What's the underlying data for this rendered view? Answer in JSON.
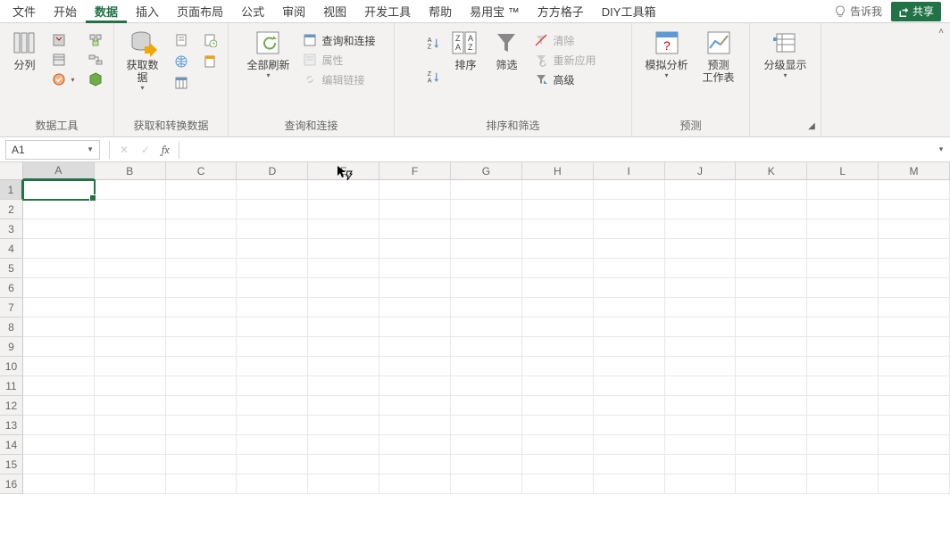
{
  "tabs": {
    "file": "文件",
    "home": "开始",
    "data": "数据",
    "insert": "插入",
    "page_layout": "页面布局",
    "formulas": "公式",
    "review": "审阅",
    "view": "视图",
    "developer": "开发工具",
    "help": "帮助",
    "yiyongbao": "易用宝 ™",
    "fangfang": "方方格子",
    "diy": "DIY工具箱",
    "tell_me": "告诉我",
    "share": "共享"
  },
  "ribbon": {
    "group_data_tools": {
      "label": "数据工具",
      "text_to_columns": "分列"
    },
    "group_get_transform": {
      "label": "获取和转换数据",
      "get_data": "获取数\n据"
    },
    "group_queries": {
      "label": "查询和连接",
      "refresh_all": "全部刷新",
      "queries_connections": "查询和连接",
      "properties": "属性",
      "edit_links": "编辑链接"
    },
    "group_sort_filter": {
      "label": "排序和筛选",
      "sort": "排序",
      "filter": "筛选",
      "clear": "清除",
      "reapply": "重新应用",
      "advanced": "高级"
    },
    "group_forecast": {
      "label": "预测",
      "whatif": "模拟分析",
      "forecast_sheet": "预测\n工作表"
    },
    "group_outline": {
      "label": "分级显示"
    }
  },
  "formula_bar": {
    "name_box": "A1",
    "fx": "fx",
    "content": ""
  },
  "grid": {
    "columns": [
      "A",
      "B",
      "C",
      "D",
      "E",
      "F",
      "G",
      "H",
      "I",
      "J",
      "K",
      "L",
      "M"
    ],
    "rows": [
      "1",
      "2",
      "3",
      "4",
      "5",
      "6",
      "7",
      "8",
      "9",
      "10",
      "11",
      "12",
      "13",
      "14",
      "15",
      "16"
    ],
    "active_cell": "A1"
  }
}
